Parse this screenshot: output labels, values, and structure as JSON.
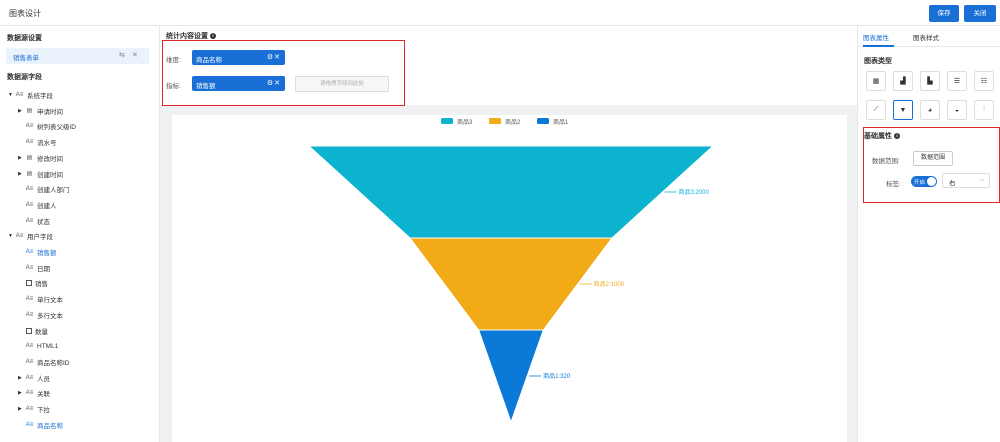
{
  "header": {
    "title": "图表设计",
    "save_label": "保存",
    "close_label": "关闭"
  },
  "left": {
    "datasource_title": "数据源设置",
    "datasource_name": "销售表单",
    "fields_title": "数据源字段",
    "system_group": "系统字段",
    "system_items": [
      {
        "label": "申请时间",
        "icon": "date-icon",
        "expandable": true
      },
      {
        "label": "树列表父级ID",
        "icon": "text-icon",
        "expandable": false
      },
      {
        "label": "流水号",
        "icon": "text-icon",
        "expandable": false
      },
      {
        "label": "修改时间",
        "icon": "date-icon",
        "expandable": true
      },
      {
        "label": "创建时间",
        "icon": "date-icon",
        "expandable": true
      },
      {
        "label": "创建人部门",
        "icon": "text-icon",
        "expandable": false
      },
      {
        "label": "创建人",
        "icon": "text-icon",
        "expandable": false
      },
      {
        "label": "状态",
        "icon": "text-icon",
        "expandable": false
      }
    ],
    "user_group": "用户字段",
    "user_items": [
      {
        "label": "销售额",
        "icon": "text-icon",
        "expandable": false,
        "highlight": true
      },
      {
        "label": "日期",
        "icon": "text-icon",
        "expandable": false
      },
      {
        "label": "销售",
        "icon": "box-icon",
        "expandable": false
      },
      {
        "label": "单行文本",
        "icon": "text-icon",
        "expandable": false
      },
      {
        "label": "多行文本",
        "icon": "text-icon",
        "expandable": false
      },
      {
        "label": "数量",
        "icon": "box-icon",
        "expandable": false
      },
      {
        "label": "HTML1",
        "icon": "text-icon",
        "expandable": false
      },
      {
        "label": "商品名称ID",
        "icon": "text-icon",
        "expandable": false
      },
      {
        "label": "人员",
        "icon": "text-icon",
        "expandable": true
      },
      {
        "label": "关联",
        "icon": "text-icon",
        "expandable": true
      },
      {
        "label": "下拉",
        "icon": "text-icon",
        "expandable": true
      },
      {
        "label": "商品名称",
        "icon": "text-icon",
        "expandable": false,
        "highlight": true
      }
    ]
  },
  "config": {
    "title": "统计内容设置",
    "dimension_label": "维度:",
    "dimension_value": "商品名称",
    "metric_label": "指标:",
    "metric_value": "销售额",
    "drop_placeholder": "请拖拽字段到此处"
  },
  "chart_data": {
    "type": "funnel",
    "categories": [
      "商品3",
      "商品2",
      "商品1"
    ],
    "values": [
      2000,
      1000,
      320
    ],
    "data_labels": [
      "商品3:2000",
      "商品2:1000",
      "商品1:320"
    ],
    "colors": [
      "#0bb3cf",
      "#f2ab17",
      "#0a79d8"
    ],
    "legend": [
      "商品3",
      "商品2",
      "商品1"
    ],
    "legend_position": "top"
  },
  "right": {
    "tab_props": "图表属性",
    "tab_style": "图表样式",
    "chart_type_title": "图表类型",
    "basic_title": "基础属性",
    "range_label": "数据范围:",
    "range_button": "数据范围",
    "label_label": "标签:",
    "toggle_text": "开启",
    "position_value": "右"
  }
}
